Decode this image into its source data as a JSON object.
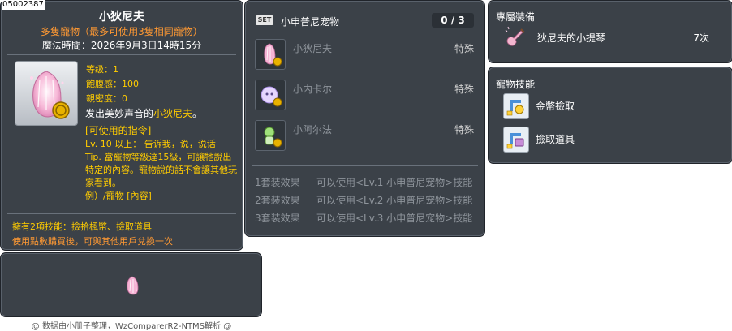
{
  "ref_id": "05002387",
  "item": {
    "title": "小狄尼夫",
    "subtitle": "多隻寵物（最多可使用3隻相同寵物）",
    "expiry": "魔法時間：2026年9月3日14時15分",
    "stats": {
      "level": "等级：1",
      "fullness": "飽腹感：100",
      "closeness": "親密度：0"
    },
    "desc_prefix": "发出美妙声音的",
    "desc_highlight": "小狄尼夫",
    "desc_suffix": "。",
    "commands_title": "[可使用的指令]",
    "commands_body": "Lv. 10 以上： 告诉我，说，说话\nTip. 當寵物等級達15級，可讓牠說出特定的內容。寵物說的話不會讓其他玩家看到。\n例）/寵物 [內容]",
    "skills_line": "擁有2項技能：撿拾楓幣、撿取道具",
    "trade_line": "使用點數購買後，可與其他用戶兌換一次"
  },
  "credit": "@ 数据由小册子整理，WzComparerR2-NTMS解析 @",
  "set": {
    "badge": "SET",
    "name": "小申普尼宠物",
    "count": "0 / 3",
    "items": [
      {
        "name": "小狄尼夫",
        "type": "特殊"
      },
      {
        "name": "小内卡尔",
        "type": "特殊"
      },
      {
        "name": "小阿尔法",
        "type": "特殊"
      }
    ],
    "effects": [
      {
        "label": "1套装效果",
        "text": "可以使用<Lv.1 小申普尼宠物>技能"
      },
      {
        "label": "2套装效果",
        "text": "可以使用<Lv.2 小申普尼宠物>技能"
      },
      {
        "label": "3套装效果",
        "text": "可以使用<Lv.3 小申普尼宠物>技能"
      }
    ]
  },
  "equip": {
    "title": "專屬裝備",
    "name": "狄尼夫的小提琴",
    "count": "7次"
  },
  "pet_skills": {
    "title": "寵物技能",
    "items": [
      {
        "name": "金幣撿取",
        "icon": "meso-pickup-icon"
      },
      {
        "name": "撿取道具",
        "icon": "item-pickup-icon"
      }
    ]
  }
}
